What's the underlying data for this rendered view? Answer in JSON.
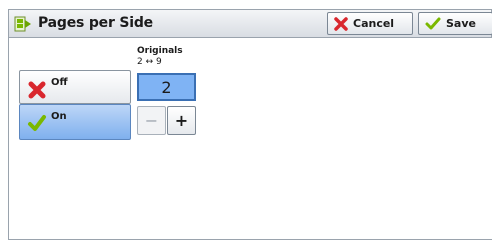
{
  "header": {
    "title": "Pages per Side",
    "cancel_label": "Cancel",
    "save_label": "Save",
    "title_icon": "pages-per-side-icon",
    "cancel_icon": "x-icon",
    "save_icon": "check-icon"
  },
  "options": {
    "off_label": "Off",
    "on_label": "On",
    "selected": "On"
  },
  "originals": {
    "label": "Originals",
    "range": "2 ↔ 9",
    "value": "2",
    "minus_label": "−",
    "plus_label": "+"
  },
  "colors": {
    "selected_blue": "#7fb0ee",
    "value_blue": "#7fb3f4",
    "cancel_red": "#d9272e",
    "check_green": "#7ab800"
  }
}
